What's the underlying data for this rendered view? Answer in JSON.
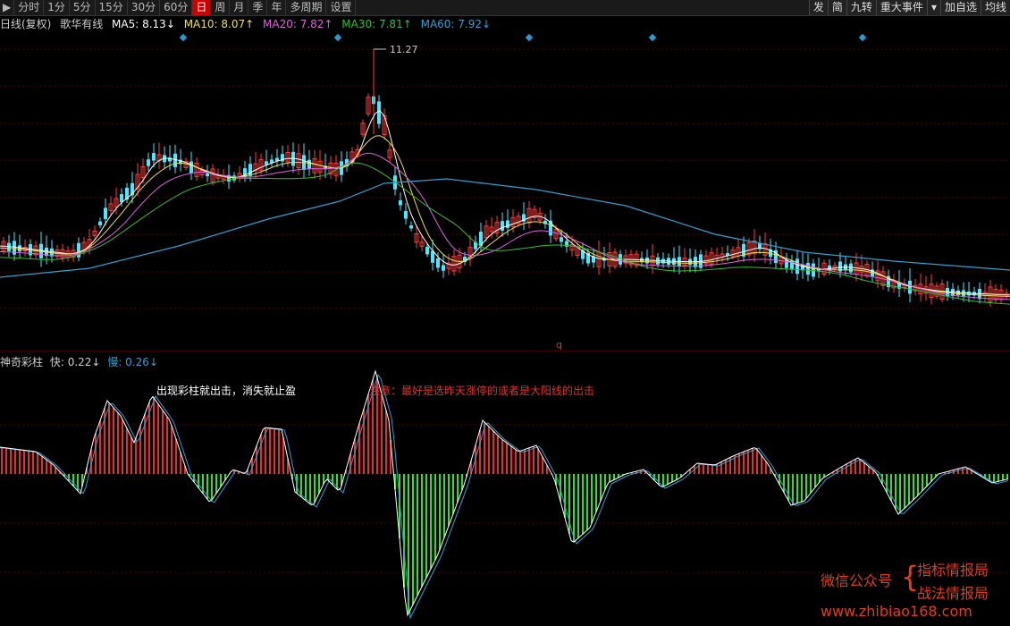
{
  "toolbar": {
    "play_icon": "play-icon",
    "periods": [
      "分时",
      "1分",
      "5分",
      "15分",
      "30分",
      "60分",
      "日",
      "周",
      "月",
      "季",
      "年",
      "多周期",
      "设置"
    ],
    "active_period": "日",
    "right_buttons": [
      "发",
      "简",
      "九转",
      "重大事件",
      "加自选",
      "均线"
    ],
    "dropdown_icon": "triangle-down-icon"
  },
  "info": {
    "title": "日线(复权)",
    "indicator": "歌华有线",
    "ma5": "MA5: 8.13↓",
    "ma10": "MA10: 8.07↑",
    "ma20": "MA20: 7.82↑",
    "ma30": "MA30: 7.81↑",
    "ma60": "MA60: 7.92↓"
  },
  "colors": {
    "up": "#ff3b3b",
    "down": "#48e8ff",
    "ma5": "#ffffff",
    "ma10": "#f0e040",
    "ma20": "#e060e0",
    "ma30": "#30c030",
    "ma60": "#2fa0d0",
    "bar_up": "#e03030",
    "bar_down": "#33dd33",
    "marker": "#2a9ad0"
  },
  "price_chart": {
    "high_label": "11.27",
    "q_marker": "q"
  },
  "oscillator": {
    "name": "神奇彩柱",
    "fast": "快: 0.22↓",
    "slow": "慢: 0.26↓",
    "annotation1": "出现彩柱就出击，消失就止盈",
    "annotation2_prefix": "注意：",
    "annotation2": "最好是选昨天涨停的或者是大阳线的出击"
  },
  "watermark": {
    "wechat": "微信公众号",
    "brace": "{",
    "name1": "指标情报局",
    "name2": "战法情报局",
    "url": "www.zhibiao168.com"
  },
  "chart_data": {
    "type": "candlestick",
    "price_high_marked": 11.27,
    "moving_averages": {
      "MA5": 8.13,
      "MA10": 8.07,
      "MA20": 7.82,
      "MA30": 7.81,
      "MA60": 7.92
    },
    "oscillator": {
      "fast": 0.22,
      "slow": 0.26
    }
  }
}
